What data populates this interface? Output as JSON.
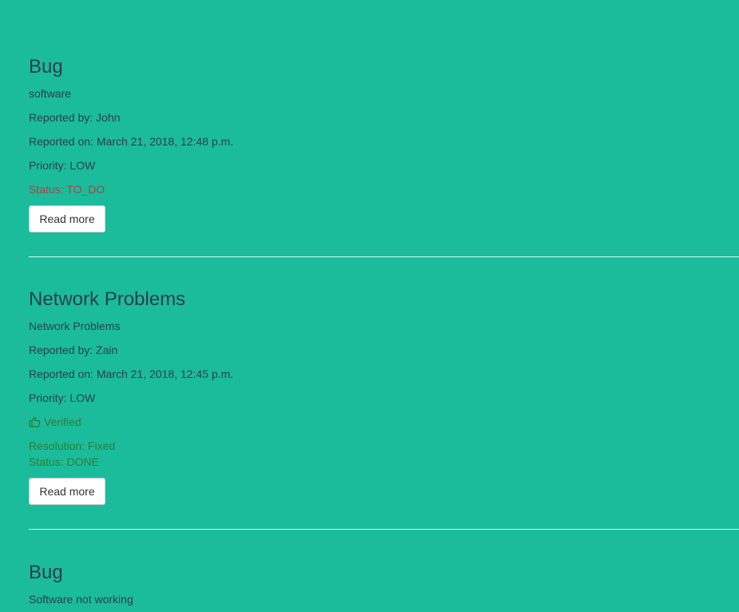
{
  "issues": [
    {
      "title": "Bug",
      "description": "software",
      "reported_by": "Reported by: John",
      "reported_on": "Reported on: March 21, 2018, 12:48 p.m.",
      "priority": "Priority: LOW",
      "status": "Status: TO_DO",
      "button": "Read more"
    },
    {
      "title": "Network Problems",
      "description": "Network Problems",
      "reported_by": "Reported by: Zain",
      "reported_on": "Reported on: March 21, 2018, 12:45 p.m.",
      "priority": "Priority: LOW",
      "verified": "Verified",
      "verified_icon": "thumbs-up-icon",
      "resolution": "Resolution: Fixed",
      "status": "Status: DONE",
      "button": "Read more"
    },
    {
      "title": "Bug",
      "description": "Software not working"
    }
  ],
  "colors": {
    "background": "#1abc9c",
    "text": "#2c3e50",
    "status_todo": "#a94442",
    "status_done": "#2f7d32",
    "divider": "#e6f7f3"
  }
}
